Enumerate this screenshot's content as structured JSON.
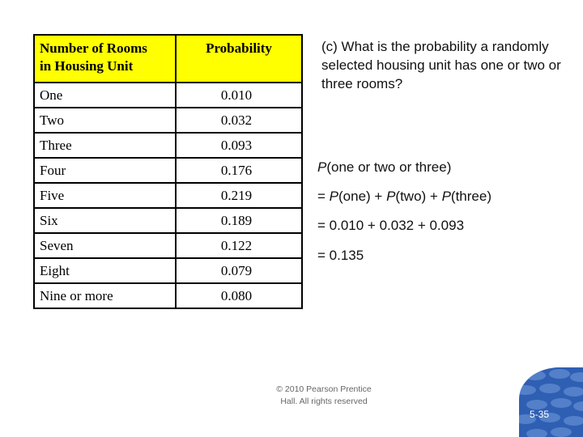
{
  "table": {
    "headers": [
      "Number of Rooms in Housing Unit",
      "Probability"
    ],
    "header_line1": "Number of Rooms",
    "header_line2": "in Housing Unit",
    "header_color": "#ffff00",
    "rows": [
      {
        "rooms": "One",
        "probability": "0.010"
      },
      {
        "rooms": "Two",
        "probability": "0.032"
      },
      {
        "rooms": "Three",
        "probability": "0.093"
      },
      {
        "rooms": "Four",
        "probability": "0.176"
      },
      {
        "rooms": "Five",
        "probability": "0.219"
      },
      {
        "rooms": "Six",
        "probability": "0.189"
      },
      {
        "rooms": "Seven",
        "probability": "0.122"
      },
      {
        "rooms": "Eight",
        "probability": "0.079"
      },
      {
        "rooms": "Nine or more",
        "probability": "0.080"
      }
    ]
  },
  "question": "(c) What is the probability a randomly selected housing unit has one or two or three rooms?",
  "solution": {
    "line1_p": "P",
    "line1_rest": "(one or two or three)",
    "line2": [
      {
        "t": "= ",
        "i": false
      },
      {
        "t": "P",
        "i": true
      },
      {
        "t": "(one) + ",
        "i": false
      },
      {
        "t": "P",
        "i": true
      },
      {
        "t": "(two) + ",
        "i": false
      },
      {
        "t": "P",
        "i": true
      },
      {
        "t": "(three)",
        "i": false
      }
    ],
    "line3": "= 0.010 + 0.032 + 0.093",
    "line4": "= 0.135"
  },
  "footer": {
    "copyright": "© 2010 Pearson Prentice Hall. All rights reserved"
  },
  "slide_number": "5-35",
  "badge_color": "#2f5fb3"
}
